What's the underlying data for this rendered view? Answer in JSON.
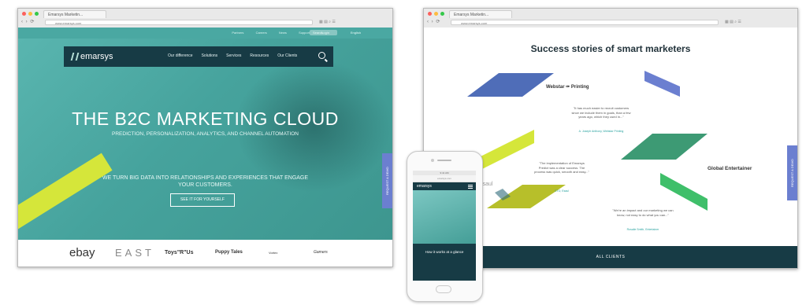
{
  "left_window": {
    "tab_title": "Emarsys Marketin...",
    "url": "www.emarsys.com",
    "top_links": [
      "Partners",
      "Careers",
      "News",
      "Support",
      "Login"
    ],
    "search_placeholder": "Search",
    "language": "English",
    "logo": "emarsys",
    "nav_links": [
      "Our difference",
      "Solutions",
      "Services",
      "Resources",
      "Our Clients"
    ],
    "hero_title": "THE B2C MARKETING CLOUD",
    "hero_subtitle": "PREDICTION, PERSONALIZATION, ANALYTICS, AND CHANNEL AUTOMATION",
    "hero_tagline": "WE TURN BIG DATA INTO RELATIONSHIPS AND EXPERIENCES THAT ENGAGE YOUR CUSTOMERS.",
    "cta": "SEE IT FOR YOURSELF",
    "side_tab": "REQUEST A DEMO",
    "client_logos": [
      "ebay",
      "EAST",
      "Toys\"R\"Us",
      "Puppy Tales",
      "Vortex",
      "Gamers"
    ]
  },
  "right_window": {
    "tab_title": "Emarsys Marketin...",
    "url": "www.emarsys.com",
    "title": "Success stories of smart marketers",
    "brands": [
      "Webstar ✑ Printing",
      "Global Entertainer",
      "Esaul"
    ],
    "quotes": [
      {
        "text": "\"It has much easier to recruit customers since we include them in goals, than a few years ago, which they used in...\"",
        "author": "A. Joseph Anthony, Webstar Printing"
      },
      {
        "text": "\"The implementation of Emarsys Predict was a clear success. The process was quick, smooth and easy...\"",
        "author": "CTO, Esaul"
      },
      {
        "text": "\"We're an impact and our marketing we can know, not easy to do what you can...\"",
        "author": "Rosalie Smith, Entertainer"
      }
    ],
    "side_tab": "REQUEST A DEMO",
    "footer": "ALL CLIENTS"
  },
  "phone": {
    "time": "9:41 AM",
    "url": "emarsys.com",
    "logo": "emarsys",
    "screen_text": "How it works at a glance"
  },
  "colors": {
    "teal": "#46a39d",
    "navy": "#173b45",
    "lime": "#d5e63a",
    "violet": "#6b7fd0",
    "green": "#3fbf6a"
  }
}
